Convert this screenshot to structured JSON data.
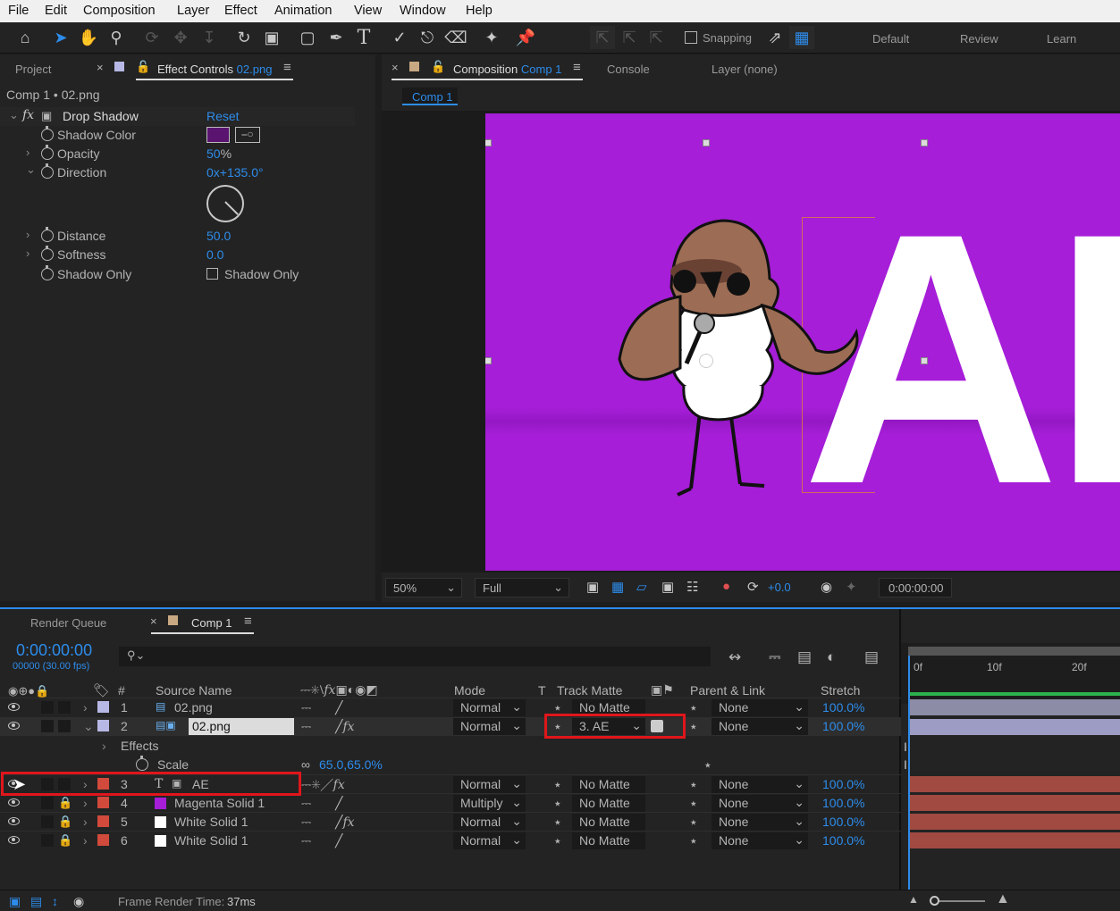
{
  "menu": [
    "File",
    "Edit",
    "Composition",
    "Layer",
    "Effect",
    "Animation",
    "View",
    "Window",
    "Help"
  ],
  "toolbar": {
    "snapping_label": "Snapping",
    "workspaces": [
      "Default",
      "Review",
      "Learn"
    ]
  },
  "left_panel": {
    "tabs": {
      "project": "Project",
      "effect_controls": "Effect Controls",
      "effect_controls_target": "02.png"
    },
    "breadcrumb": "Comp 1 • 02.png",
    "effect_name": "Drop Shadow",
    "reset_label": "Reset",
    "properties": {
      "shadow_color": {
        "label": "Shadow Color",
        "color": "#5a1470"
      },
      "opacity": {
        "label": "Opacity",
        "value": "50",
        "unit": "%"
      },
      "direction": {
        "label": "Direction",
        "value": "0x+135.0°"
      },
      "distance": {
        "label": "Distance",
        "value": "50.0"
      },
      "softness": {
        "label": "Softness",
        "value": "0.0"
      },
      "shadow_only": {
        "label": "Shadow Only",
        "checkbox_label": "Shadow Only"
      }
    }
  },
  "comp_panel": {
    "tab_label": "Composition",
    "tab_target": "Comp 1",
    "console_label": "Console",
    "layer_label": "Layer (none)",
    "breadcrumb_tab": "Comp 1",
    "canvas_text": "AE",
    "canvas_color": "#a61ed8",
    "zoom": "50%",
    "resolution": "Full",
    "exposure": "+0.0",
    "timecode": "0:00:00:00"
  },
  "timeline": {
    "tabs": {
      "render_queue": "Render Queue",
      "comp": "Comp 1"
    },
    "current_time": "0:00:00:00",
    "frame_info": "00000 (30.00 fps)",
    "search_placeholder": "",
    "headers": {
      "number": "#",
      "source_name": "Source Name",
      "mode": "Mode",
      "t": "T",
      "track_matte": "Track Matte",
      "parent_link": "Parent & Link",
      "stretch": "Stretch"
    },
    "ruler": [
      "0f",
      "10f",
      "20f"
    ],
    "layers": [
      {
        "num": "1",
        "name": "02.png",
        "mode": "Normal",
        "matte": "No Matte",
        "parent": "None",
        "stretch": "100.0%",
        "color": "#b8b8e6",
        "type": "footage"
      },
      {
        "num": "2",
        "name": "02.png",
        "mode": "Normal",
        "matte": "3. AE",
        "parent": "None",
        "stretch": "100.0%",
        "color": "#b8b8e6",
        "type": "footage"
      },
      {
        "num": "3",
        "name": "AE",
        "mode": "Normal",
        "matte": "No Matte",
        "parent": "None",
        "stretch": "100.0%",
        "color": "#d14a3c",
        "type": "text"
      },
      {
        "num": "4",
        "name": "Magenta Solid 1",
        "mode": "Multiply",
        "matte": "No Matte",
        "parent": "None",
        "stretch": "100.0%",
        "color": "#d14a3c",
        "type": "solid",
        "swatch": "#a61ed8"
      },
      {
        "num": "5",
        "name": "White Solid 1",
        "mode": "Normal",
        "matte": "No Matte",
        "parent": "None",
        "stretch": "100.0%",
        "color": "#d14a3c",
        "type": "solid",
        "swatch": "#ffffff"
      },
      {
        "num": "6",
        "name": "White Solid 1",
        "mode": "Normal",
        "matte": "No Matte",
        "parent": "None",
        "stretch": "100.0%",
        "color": "#d14a3c",
        "type": "solid",
        "swatch": "#ffffff"
      }
    ],
    "effects_label": "Effects",
    "scale_label": "Scale",
    "scale_value": "65.0,65.0%",
    "frame_render_label": "Frame Render Time:",
    "frame_render_value": "37ms"
  }
}
